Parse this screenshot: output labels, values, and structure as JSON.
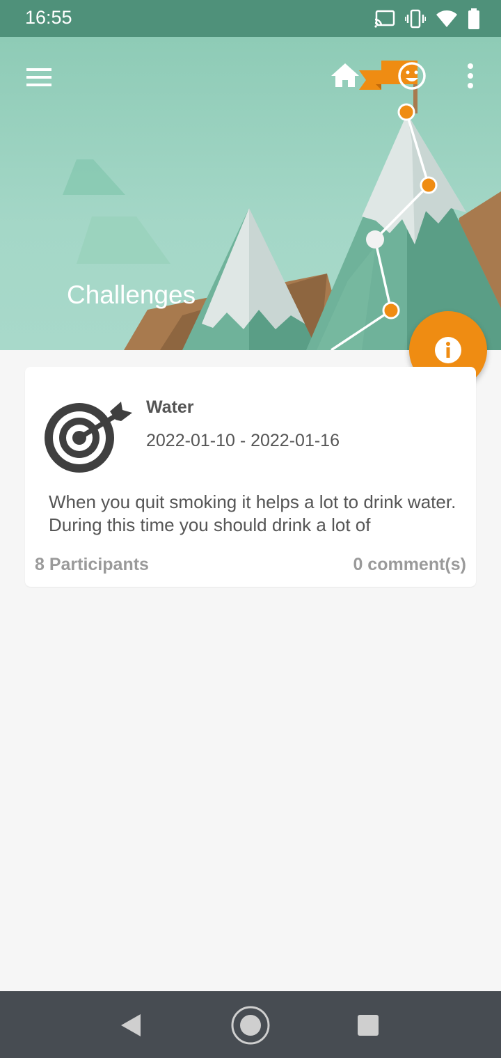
{
  "status_bar": {
    "time": "16:55",
    "icons": [
      "cast-icon",
      "vibrate-icon",
      "wifi-icon",
      "battery-icon"
    ]
  },
  "header": {
    "title": "Challenges",
    "icons": [
      "menu-icon",
      "home-icon",
      "smiley-icon",
      "more-vert-icon"
    ]
  },
  "fab": {
    "icon": "info-icon",
    "color": "#ef8c12"
  },
  "challenge": {
    "icon": "target-icon",
    "title": "Water",
    "dates": "2022-01-10 - 2022-01-16",
    "description": "When you quit smoking it helps a lot to drink water. During this time you should drink a lot of",
    "participants": "8 Participants",
    "comments": "0 comment(s)"
  },
  "nav_bar": {
    "icons": [
      "back-icon",
      "home-circle-icon",
      "recent-apps-icon"
    ]
  },
  "colors": {
    "status_bar": "#4f917a",
    "accent": "#ef8c12",
    "header_sky": "#a4d7c7"
  }
}
